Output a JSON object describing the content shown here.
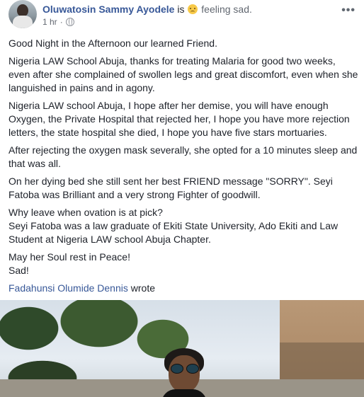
{
  "post": {
    "author": "Oluwatosin Sammy Ayodele",
    "is_text": "is",
    "feeling_icon": "sad-face-icon",
    "feeling": "feeling sad.",
    "time": "1 hr",
    "privacy_icon": "globe-icon",
    "more_icon": "more-options-icon"
  },
  "body": {
    "paragraphs": [
      "Good Night in the Afternoon our learned Friend.",
      "Nigeria LAW School Abuja, thanks for treating Malaria for good two weeks, even after she complained of swollen legs and great discomfort, even when she languished in pains and in agony.",
      "Nigeria LAW school Abuja, I hope after her demise, you will have enough Oxygen, the Private Hospital that rejected her, I hope you have more rejection letters, the state hospital she died, I hope you have five stars mortuaries.",
      "After rejecting the oxygen mask severally, she opted for a 10 minutes sleep and that was all.",
      "On her dying bed she still sent her best FRIEND message \"SORRY\". Seyi Fatoba was Brilliant and a very strong Fighter of goodwill."
    ],
    "p6_line1": "Why leave when ovation is at pick?",
    "p6_line2": "Seyi Fatoba was a law graduate of Ekiti State University, Ado Ekiti and Law Student at Nigeria LAW school Abuja Chapter.",
    "p7_line1": "May her Soul rest in Peace!",
    "p7_line2": "Sad!",
    "credit_name": "Fadahunsi Olumide Dennis",
    "credit_suffix": " wrote"
  }
}
